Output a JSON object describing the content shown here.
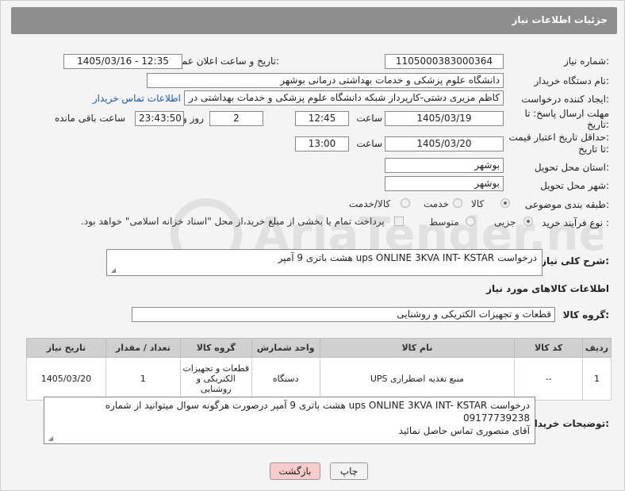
{
  "header": {
    "title": "جزئیات اطلاعات نیاز"
  },
  "form": {
    "need_number_label": "شماره نیاز:",
    "need_number": "1105000383000364",
    "announce_label": "تاریخ و ساعت اعلان عمومی:",
    "announce_value": "1405/03/16 - 12:35",
    "buyer_label": "نام دستگاه خریدار:",
    "buyer_value": "دانشگاه علوم پزشکی و خدمات بهداشتی درمانی بوشهر",
    "creator_label": "ایجاد کننده درخواست:",
    "creator_value": "کاظم مزیری دشتی-کارپرداز شبکه دانشگاه علوم پزشکی و خدمات بهداشتی در",
    "contact_link": "اطلاعات تماس خریدار",
    "deadline_label_1": "مهلت ارسال پاسخ: تا",
    "deadline_label_2": "تاریخ:",
    "deadline_date": "1405/03/19",
    "time_label": "ساعت",
    "deadline_time": "12:45",
    "days_value": "2",
    "days_label": "روز و",
    "remaining_value": "23:43:50",
    "remaining_label": "ساعت باقی مانده",
    "price_label_1": "حداقل تاریخ اعتبار قیمت:",
    "price_label_2": "تا تاریخ:",
    "price_date": "1405/03/20",
    "price_time": "13:00",
    "province_label": "استان محل تحویل:",
    "province_value": "بوشهر",
    "city_label": "شهر محل تحویل:",
    "city_value": "بوشهر",
    "category_label": "طبقه بندی موضوعی:",
    "category_options": [
      "کالا",
      "خدمت",
      "کالا/خدمت"
    ],
    "process_label": "نوع فرآیند خرید :",
    "process_options": [
      "جزیی",
      "متوسط"
    ],
    "payment_text": "پرداخت تمام یا بخشی از مبلغ خرید،از محل \"اسناد خزانه اسلامی\" خواهد بود."
  },
  "description": {
    "label": "شرح کلی نیاز:",
    "value": "درخواست ups ONLINE 3KVA INT- KSTAR   هشت باتری 9 آمپر"
  },
  "goods_info": {
    "title": "اطلاعات کالاهای مورد نیاز",
    "group_label": "گروه کالا:",
    "group_value": "قطعات و تجهیزات الکتریکی و روشنایی"
  },
  "table": {
    "headers": [
      "ردیف",
      "کد کالا",
      "نام کالا",
      "واحد شمارش",
      "گروه کالا",
      "تعداد / مقدار",
      "تاریخ نیاز"
    ],
    "rows": [
      {
        "row": "1",
        "code": "--",
        "name": "منبع تغذیه اضطراری UPS",
        "unit": "دستگاه",
        "group": "قطعات و تجهیزات الکتریکی و روشنایی",
        "qty": "1",
        "date": "1405/03/20"
      }
    ]
  },
  "buyer_notes": {
    "label": "توضیحات خریدار:",
    "line1": "درخواست ups ONLINE 3KVA INT- KSTAR   هشت باتری 9 آمپر درصورت هرگونه سوال میتوانید از شماره 09177739238",
    "line2": "آقای منصوری تماس حاصل نمائید"
  },
  "buttons": {
    "print": "چاپ",
    "back": "بازگشت"
  },
  "watermark": {
    "text": "AriaTender.neT"
  }
}
